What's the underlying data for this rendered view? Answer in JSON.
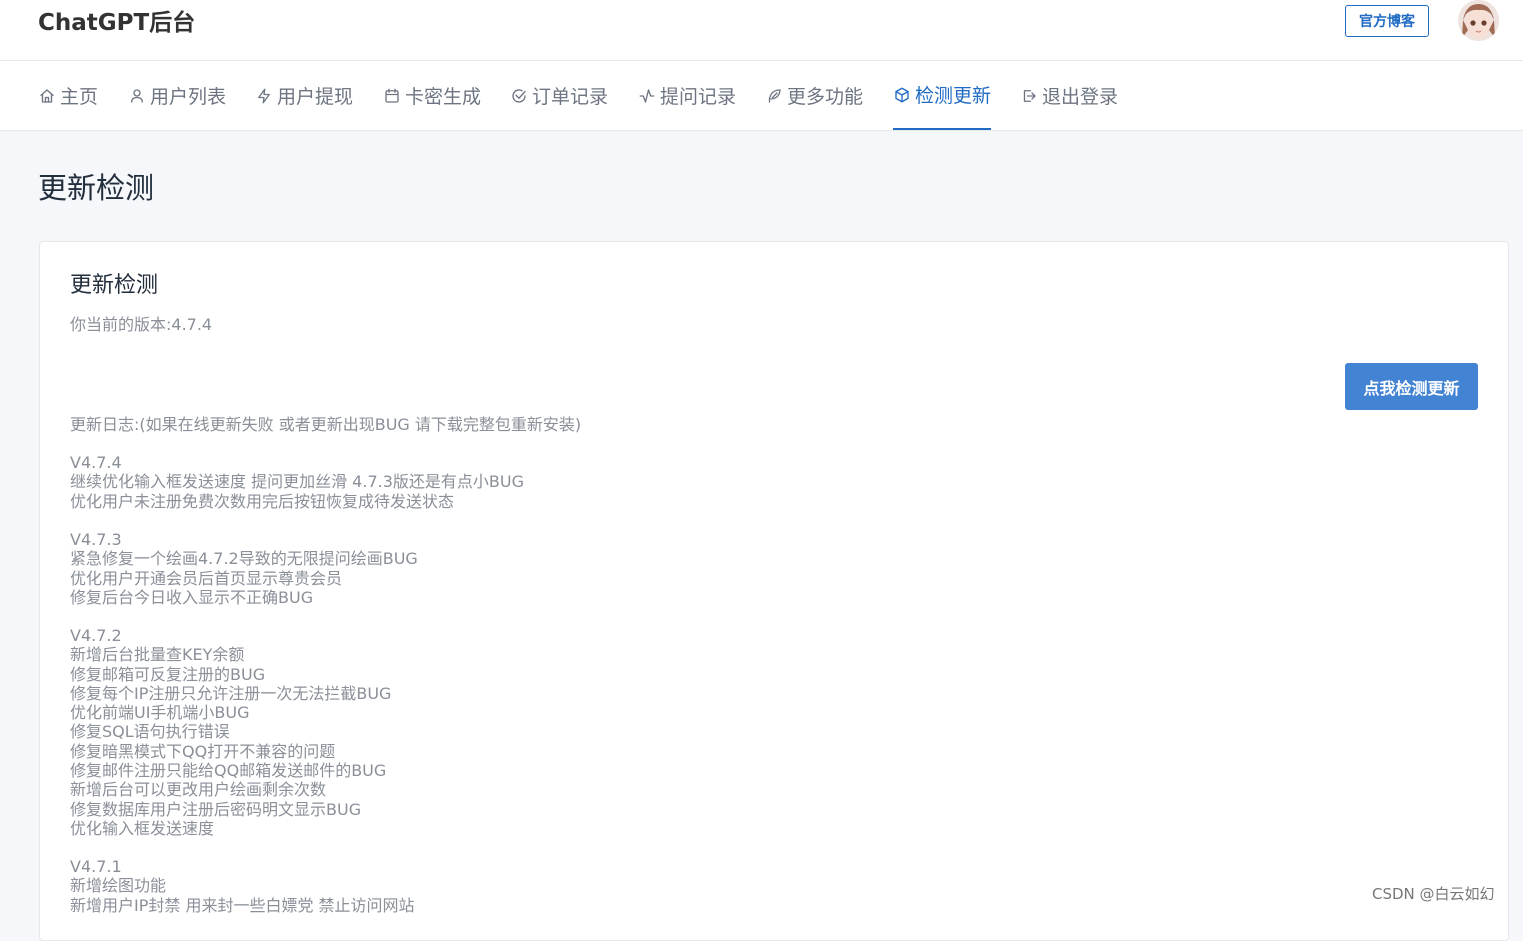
{
  "app": {
    "title": "ChatGPT后台",
    "blog_button": "官方博客"
  },
  "nav": [
    {
      "label": "主页",
      "icon": "home-icon",
      "active": false
    },
    {
      "label": "用户列表",
      "icon": "user-icon",
      "active": false
    },
    {
      "label": "用户提现",
      "icon": "bolt-icon",
      "active": false
    },
    {
      "label": "卡密生成",
      "icon": "calendar-icon",
      "active": false
    },
    {
      "label": "订单记录",
      "icon": "check-circle-icon",
      "active": false
    },
    {
      "label": "提问记录",
      "icon": "activity-icon",
      "active": false
    },
    {
      "label": "更多功能",
      "icon": "feather-icon",
      "active": false
    },
    {
      "label": "检测更新",
      "icon": "box-icon",
      "active": true
    },
    {
      "label": "退出登录",
      "icon": "logout-icon",
      "active": false
    }
  ],
  "page": {
    "title": "更新检测"
  },
  "card": {
    "title": "更新检测",
    "current_version": "你当前的版本:4.7.4",
    "check_button": "点我检测更新",
    "log_header": "更新日志:(如果在线更新失败 或者更新出现BUG 请下载完整包重新安装)",
    "releases": [
      {
        "version": "V4.7.4",
        "items": [
          "继续优化输入框发送速度 提问更加丝滑 4.7.3版还是有点小BUG",
          "优化用户未注册免费次数用完后按钮恢复成待发送状态"
        ]
      },
      {
        "version": "V4.7.3",
        "items": [
          "紧急修复一个绘画4.7.2导致的无限提问绘画BUG",
          "优化用户开通会员后首页显示尊贵会员",
          "修复后台今日收入显示不正确BUG"
        ]
      },
      {
        "version": "V4.7.2",
        "items": [
          "新增后台批量查KEY余额",
          "修复邮箱可反复注册的BUG",
          "修复每个IP注册只允许注册一次无法拦截BUG",
          "优化前端UI手机端小BUG",
          "修复SQL语句执行错误",
          "修复暗黑模式下QQ打开不兼容的问题",
          "修复邮件注册只能给QQ邮箱发送邮件的BUG",
          "新增后台可以更改用户绘画剩余次数",
          "修复数据库用户注册后密码明文显示BUG",
          "优化输入框发送速度"
        ]
      },
      {
        "version": "V4.7.1",
        "items": [
          "新增绘图功能",
          "新增用户IP封禁 用来封一些白嫖党 禁止访问网站"
        ]
      }
    ]
  },
  "watermark": "CSDN @白云如幻",
  "colors": {
    "accent": "#206bc4",
    "button": "#4383d4",
    "muted_text": "#8a8f98"
  }
}
